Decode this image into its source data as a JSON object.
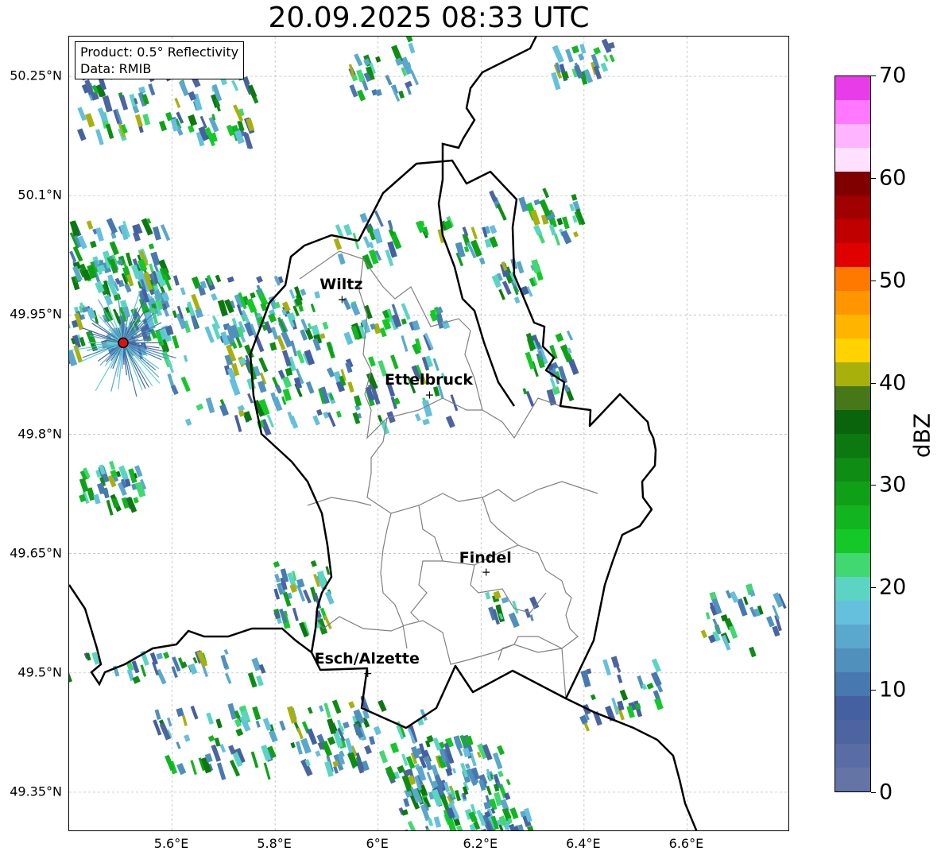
{
  "title": "20.09.2025 08:33 UTC",
  "info_box": {
    "product": "Product: 0.5° Reflectivity",
    "data": "Data: RMIB"
  },
  "lat_ticks": [
    {
      "value": 50.25,
      "label": "50.25°N"
    },
    {
      "value": 50.1,
      "label": "50.1°N"
    },
    {
      "value": 49.95,
      "label": "49.95°N"
    },
    {
      "value": 49.8,
      "label": "49.8°N"
    },
    {
      "value": 49.65,
      "label": "49.65°N"
    },
    {
      "value": 49.5,
      "label": "49.5°N"
    },
    {
      "value": 49.35,
      "label": "49.35°N"
    }
  ],
  "lon_ticks": [
    {
      "value": 5.6,
      "label": "5.6°E"
    },
    {
      "value": 5.8,
      "label": "5.8°E"
    },
    {
      "value": 6.0,
      "label": "6°E"
    },
    {
      "value": 6.2,
      "label": "6.2°E"
    },
    {
      "value": 6.4,
      "label": "6.4°E"
    },
    {
      "value": 6.6,
      "label": "6.6°E"
    }
  ],
  "extent": {
    "lon_min": 5.4,
    "lon_max": 6.8,
    "lat_min": 49.3,
    "lat_max": 50.3
  },
  "cities": [
    {
      "name": "Wiltz",
      "lon": 5.93,
      "lat": 49.97
    },
    {
      "name": "Ettelbruck",
      "lon": 6.1,
      "lat": 49.85
    },
    {
      "name": "Findel",
      "lon": 6.21,
      "lat": 49.627
    },
    {
      "name": "Esch/Alzette",
      "lon": 5.98,
      "lat": 49.5
    }
  ],
  "radar_site": {
    "lon": 5.505,
    "lat": 49.915,
    "color": "#e01010"
  },
  "colorbar": {
    "label": "dBZ",
    "min": 0,
    "max": 70,
    "ticks": [
      0,
      10,
      20,
      30,
      40,
      50,
      60,
      70
    ],
    "colors": [
      "#6474a4",
      "#5a6ca4",
      "#4c64a0",
      "#4460a0",
      "#4878b0",
      "#5090bc",
      "#5aa8cc",
      "#64c0dc",
      "#5cd4c4",
      "#40d870",
      "#14c828",
      "#12b420",
      "#10a018",
      "#0e8c14",
      "#0c7810",
      "#0a640c",
      "#46781a",
      "#a8b00c",
      "#ffd200",
      "#ffb400",
      "#ff9600",
      "#ff7800",
      "#e00000",
      "#c00000",
      "#a00000",
      "#800000",
      "#ffe0ff",
      "#ffb4ff",
      "#ff78ff",
      "#e83ce8"
    ]
  },
  "colors": {
    "border": "#000000",
    "canton": "#808080",
    "grid": "#b4b4b4"
  }
}
